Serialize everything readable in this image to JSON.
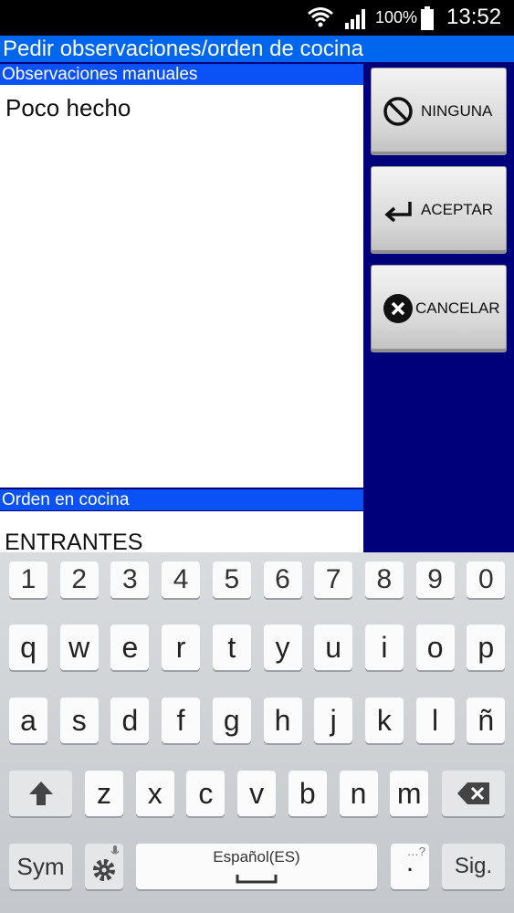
{
  "status_bar": {
    "battery": "100%",
    "time": "13:52",
    "icons": [
      "wifi-icon",
      "signal-icon",
      "battery-icon"
    ]
  },
  "app": {
    "title": "Pedir observaciones/orden de cocina",
    "manual_section": {
      "header": "Observaciones manuales",
      "value": "Poco hecho"
    },
    "order_section": {
      "header": "Orden en cocina",
      "value": "ENTRANTES"
    },
    "buttons": {
      "none": {
        "label": "NINGUNA",
        "icon": "no-icon"
      },
      "accept": {
        "label": "ACEPTAR",
        "icon": "enter-arrow-icon"
      },
      "cancel": {
        "label": "CANCELAR",
        "icon": "close-icon"
      }
    },
    "colors": {
      "title_bar": "#0066ee",
      "section_header": "#0a52f5",
      "background": "#00007a"
    }
  },
  "keyboard": {
    "number_row": [
      "1",
      "2",
      "3",
      "4",
      "5",
      "6",
      "7",
      "8",
      "9",
      "0"
    ],
    "row1": [
      "q",
      "w",
      "e",
      "r",
      "t",
      "y",
      "u",
      "i",
      "o",
      "p"
    ],
    "row2": [
      "a",
      "s",
      "d",
      "f",
      "g",
      "h",
      "j",
      "k",
      "l",
      "ñ"
    ],
    "row3": [
      "z",
      "x",
      "c",
      "v",
      "b",
      "n",
      "m"
    ],
    "sym_label": "Sym",
    "space_label": "Español(ES)",
    "period": ".",
    "period_hint": "…?",
    "next_label": "Sig."
  }
}
